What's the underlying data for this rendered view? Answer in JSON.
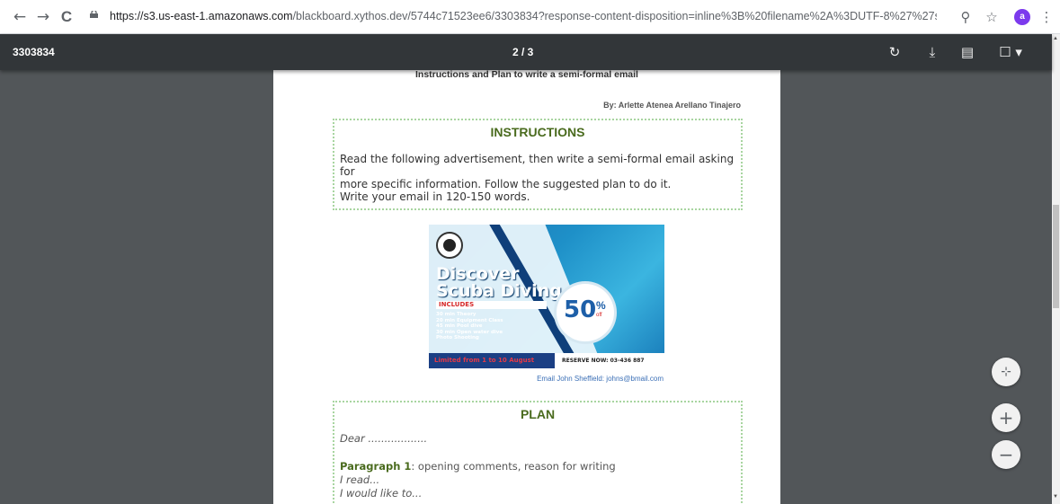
{
  "browser": {
    "back_icon": "←",
    "forward_icon": "→",
    "reload_icon": "C",
    "url_host": "https://s3.us-east-1.amazonaws.com",
    "url_path": "/blackboard.xythos.dev/5744c71523ee6/3303834?response-content-disposition=inline%3B%20filename%2A%3DUTF-8%27%27semi-for...",
    "zoom_icon": "⚲",
    "star_icon": "☆",
    "avatar_letter": "a",
    "menu_icon": "⋮"
  },
  "pdf_toolbar": {
    "title": "3303834",
    "page_indicator": "2 / 3",
    "rotate_icon": "↻",
    "download_icon": "⤓",
    "print_icon": "▤",
    "bookmark_icon": "☐ ▾"
  },
  "document": {
    "title": "Instructions and Plan to write a semi-formal email",
    "author": "By: Arlette Atenea Arellano Tinajero",
    "instructions_heading": "INSTRUCTIONS",
    "instructions_line1": "Read the following advertisement, then write a semi-formal email asking for",
    "instructions_line2": "more specific information. Follow the suggested plan to do it.",
    "instructions_line3": "Write your email in 120-150 words.",
    "plan_heading": "PLAN",
    "plan_dear": "Dear ..................",
    "plan_paragraph_label": "Paragraph 1",
    "plan_paragraph_text": ":  opening comments, reason for writing",
    "plan_i_read": "I read...",
    "plan_i_would": "I would like to..."
  },
  "ad": {
    "title_line1": "Discover",
    "title_line2": "Scuba Diving",
    "includes_label": "INCLUDES",
    "items": [
      "30 min Theory",
      "20 min Equipment Class",
      "45 min Pool dive",
      "30 min Open water dive",
      "Photo Shooting"
    ],
    "discount": "50",
    "percent": "%",
    "off": "off",
    "valid": "Limited from 1 to 10 August",
    "reserve": "RESERVE NOW: 03-436 887",
    "email": "Email John Sheffield: johns@bmail.com"
  },
  "zoom": {
    "fit_icon": "⊹",
    "zoom_in_icon": "+",
    "zoom_out_icon": "−"
  }
}
